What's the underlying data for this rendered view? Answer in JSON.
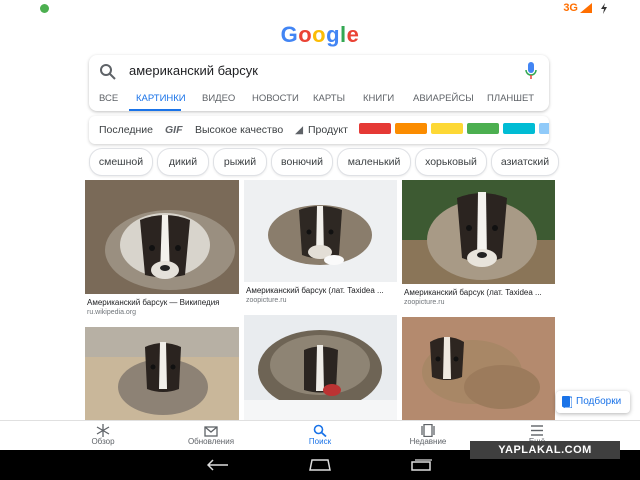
{
  "status_bar": {
    "network": "3G"
  },
  "logo": {
    "letters": [
      "G",
      "o",
      "o",
      "g",
      "l",
      "e"
    ],
    "colors": [
      "#4285F4",
      "#EA4335",
      "#FBBC05",
      "#4285F4",
      "#34A853",
      "#EA4335"
    ]
  },
  "search": {
    "query": "американский барсук"
  },
  "tabs": [
    {
      "label": "ВСЕ",
      "active": false
    },
    {
      "label": "КАРТИНКИ",
      "active": true
    },
    {
      "label": "ВИДЕО",
      "active": false
    },
    {
      "label": "НОВОСТИ",
      "active": false
    },
    {
      "label": "КАРТЫ",
      "active": false
    },
    {
      "label": "КНИГИ",
      "active": false
    },
    {
      "label": "АВИАРЕЙСЫ",
      "active": false
    },
    {
      "label": "ПЛАНШЕТ",
      "active": false
    }
  ],
  "filters": {
    "recent": "Последние",
    "gif": "GIF",
    "hq": "Высокое качество",
    "product": "Продукт",
    "colors": [
      "#e53935",
      "#fb8c00",
      "#fdd835",
      "#4caf50",
      "#00bcd4",
      "#90caf9"
    ]
  },
  "chips": [
    "смешной",
    "дикий",
    "рыжий",
    "вонючий",
    "маленький",
    "хорьковый",
    "азиатский"
  ],
  "results": [
    {
      "caption": "Американский барсук — Википедия",
      "source": "ru.wikipedia.org"
    },
    {
      "caption": "Американский барсук (лат. Taxidea ...",
      "source": "zoopicture.ru"
    },
    {
      "caption": "Американский барсук (лат. Taxidea ...",
      "source": "zoopicture.ru"
    }
  ],
  "collections_button": "Подборки",
  "bottom_nav": [
    {
      "label": "Обзор",
      "icon": "asterisk-icon",
      "active": false
    },
    {
      "label": "Обновления",
      "icon": "updates-icon",
      "active": false
    },
    {
      "label": "Поиск",
      "icon": "search-icon",
      "active": true
    },
    {
      "label": "Недавние",
      "icon": "recent-icon",
      "active": false
    },
    {
      "label": "Ещё",
      "icon": "menu-icon",
      "active": false
    }
  ],
  "watermark": "YAPLAKAL.COM"
}
